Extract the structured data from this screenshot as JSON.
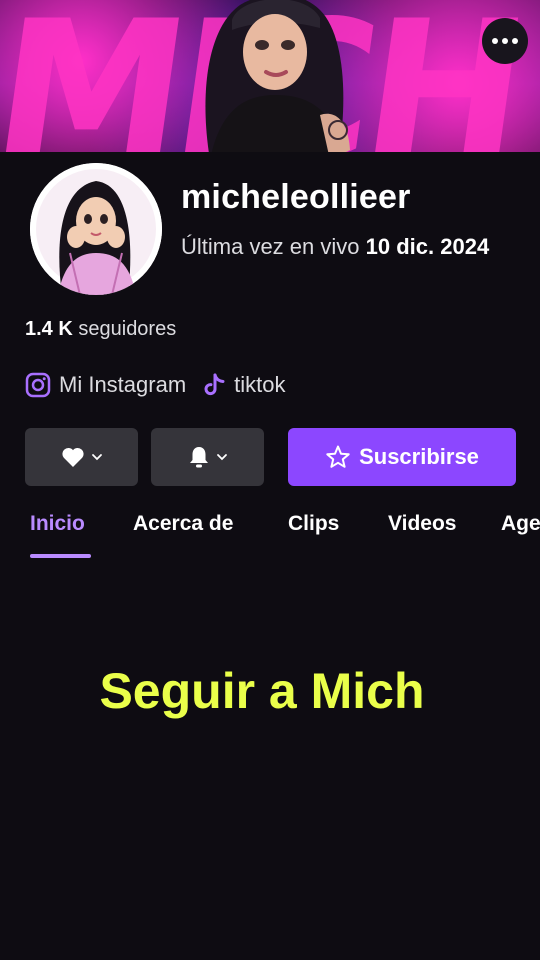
{
  "banner": {
    "letters": "MICH",
    "more_icon": "more-horizontal-icon"
  },
  "profile": {
    "username": "micheleollieer",
    "last_live_prefix": "Última vez en vivo",
    "last_live_date": "10 dic. 2024",
    "followers_count": "1.4 K",
    "followers_label": "seguidores"
  },
  "social": [
    {
      "label": "Mi Instagram",
      "icon": "instagram-icon"
    },
    {
      "label": "tiktok",
      "icon": "tiktok-icon"
    }
  ],
  "actions": {
    "follow_icon": "heart-icon",
    "notify_icon": "bell-icon",
    "subscribe_label": "Suscribirse"
  },
  "tabs": [
    {
      "label": "Inicio",
      "active": true
    },
    {
      "label": "Acerca de",
      "active": false
    },
    {
      "label": "Clips",
      "active": false
    },
    {
      "label": "Videos",
      "active": false
    },
    {
      "label": "Agenda",
      "active": false
    }
  ],
  "caption": "Seguir a Mich",
  "colors": {
    "accent": "#8c47ff",
    "tab_active": "#b98bff",
    "caption": "#eaff4a",
    "background": "#0e0c12",
    "button_dark": "#35343a"
  }
}
